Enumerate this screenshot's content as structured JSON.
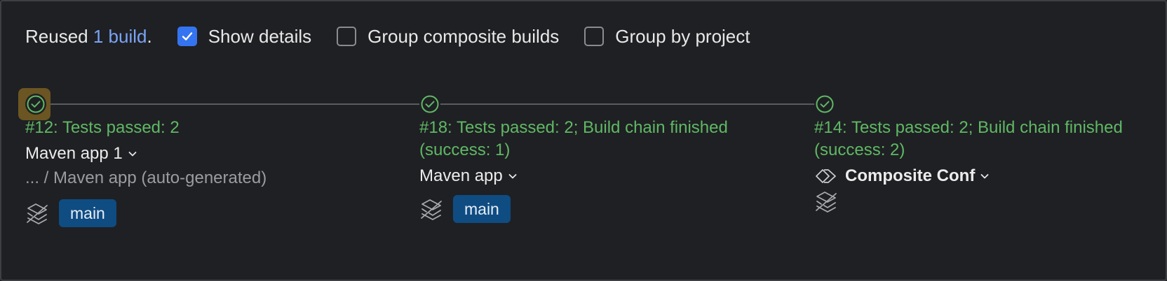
{
  "header": {
    "reused_prefix": "Reused",
    "reused_link": "1 build",
    "reused_suffix": ".",
    "checkboxes": [
      {
        "label": "Show details",
        "checked": true
      },
      {
        "label": "Group composite builds",
        "checked": false
      },
      {
        "label": "Group by project",
        "checked": false
      }
    ]
  },
  "builds": [
    {
      "status": "#12: Tests passed: 2",
      "config": "Maven app 1",
      "path": "... / Maven app (auto-generated)",
      "branch": "main"
    },
    {
      "status_line1": "#18: Tests passed: 2; Build chain finished",
      "status_line2": "(success: 1)",
      "config": "Maven app",
      "branch": "main"
    },
    {
      "status_line1": "#14: Tests passed: 2; Build chain finished",
      "status_line2": "(success: 2)",
      "config": "Composite Conf"
    }
  ],
  "colors": {
    "success": "#5fb865",
    "link": "#7aa3f5",
    "branch_tag": "#0f4c82",
    "checkbox_checked": "#3574f0"
  },
  "icons": [
    "check-circle-icon",
    "layers-icon",
    "composite-icon",
    "chevron-down-icon",
    "checkmark-icon"
  ]
}
